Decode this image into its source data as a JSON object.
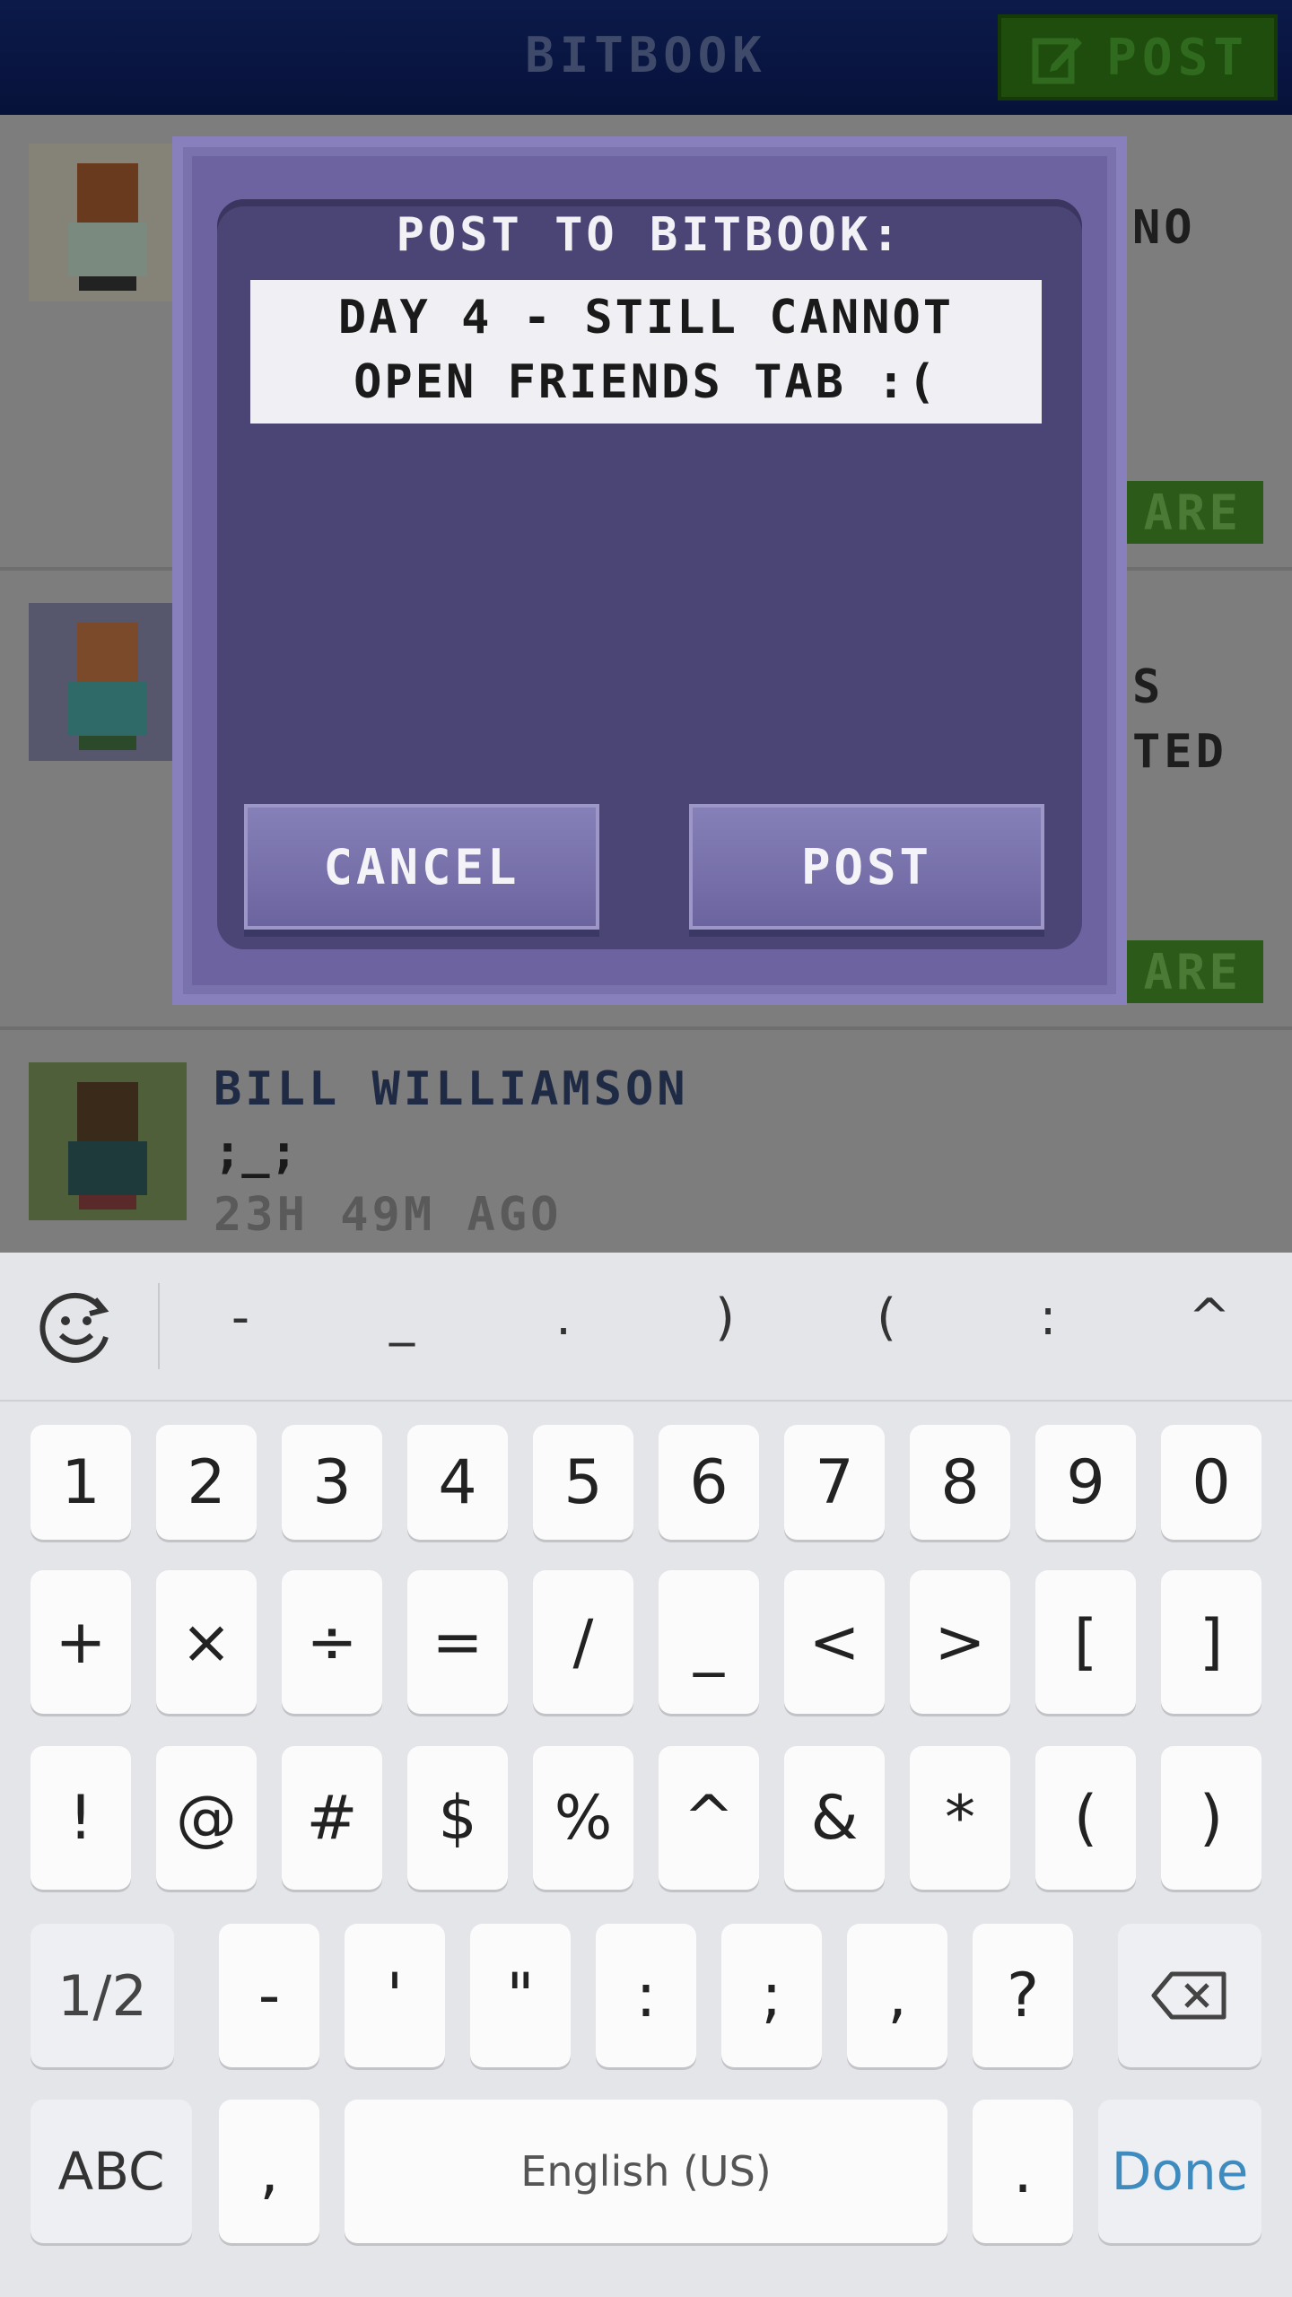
{
  "app": {
    "title": "BITBOOK",
    "post_button": "POST"
  },
  "feed": {
    "item1": {
      "right_text": "NO",
      "share_label": "ARE"
    },
    "item2": {
      "right_text_1": "S",
      "right_text_2": "TED",
      "share_label": "ARE"
    },
    "item3": {
      "name": "BILL WILLIAMSON",
      "body": ";_;",
      "time": "23H 49M AGO"
    }
  },
  "dialog": {
    "title": "POST TO BITBOOK:",
    "text_line1": "DAY 4 - STILL CANNOT",
    "text_line2": "OPEN FRIENDS TAB :(",
    "cancel_label": "CANCEL",
    "post_label": "POST"
  },
  "keyboard": {
    "suggestions": [
      "-",
      "_",
      ".",
      ")",
      "(",
      ":",
      "^"
    ],
    "row1": [
      "1",
      "2",
      "3",
      "4",
      "5",
      "6",
      "7",
      "8",
      "9",
      "0"
    ],
    "row2": [
      "+",
      "×",
      "÷",
      "=",
      "/",
      "_",
      "<",
      ">",
      "[",
      "]"
    ],
    "row3": [
      "!",
      "@",
      "#",
      "$",
      "%",
      "^",
      "&",
      "*",
      "(",
      ")"
    ],
    "row4": [
      "1/2",
      "-",
      "'",
      "\"",
      ":",
      ";",
      ",",
      "?"
    ],
    "row5": {
      "abc": "ABC",
      "comma": ",",
      "space": "English (US)",
      "period": ".",
      "done": "Done"
    }
  }
}
